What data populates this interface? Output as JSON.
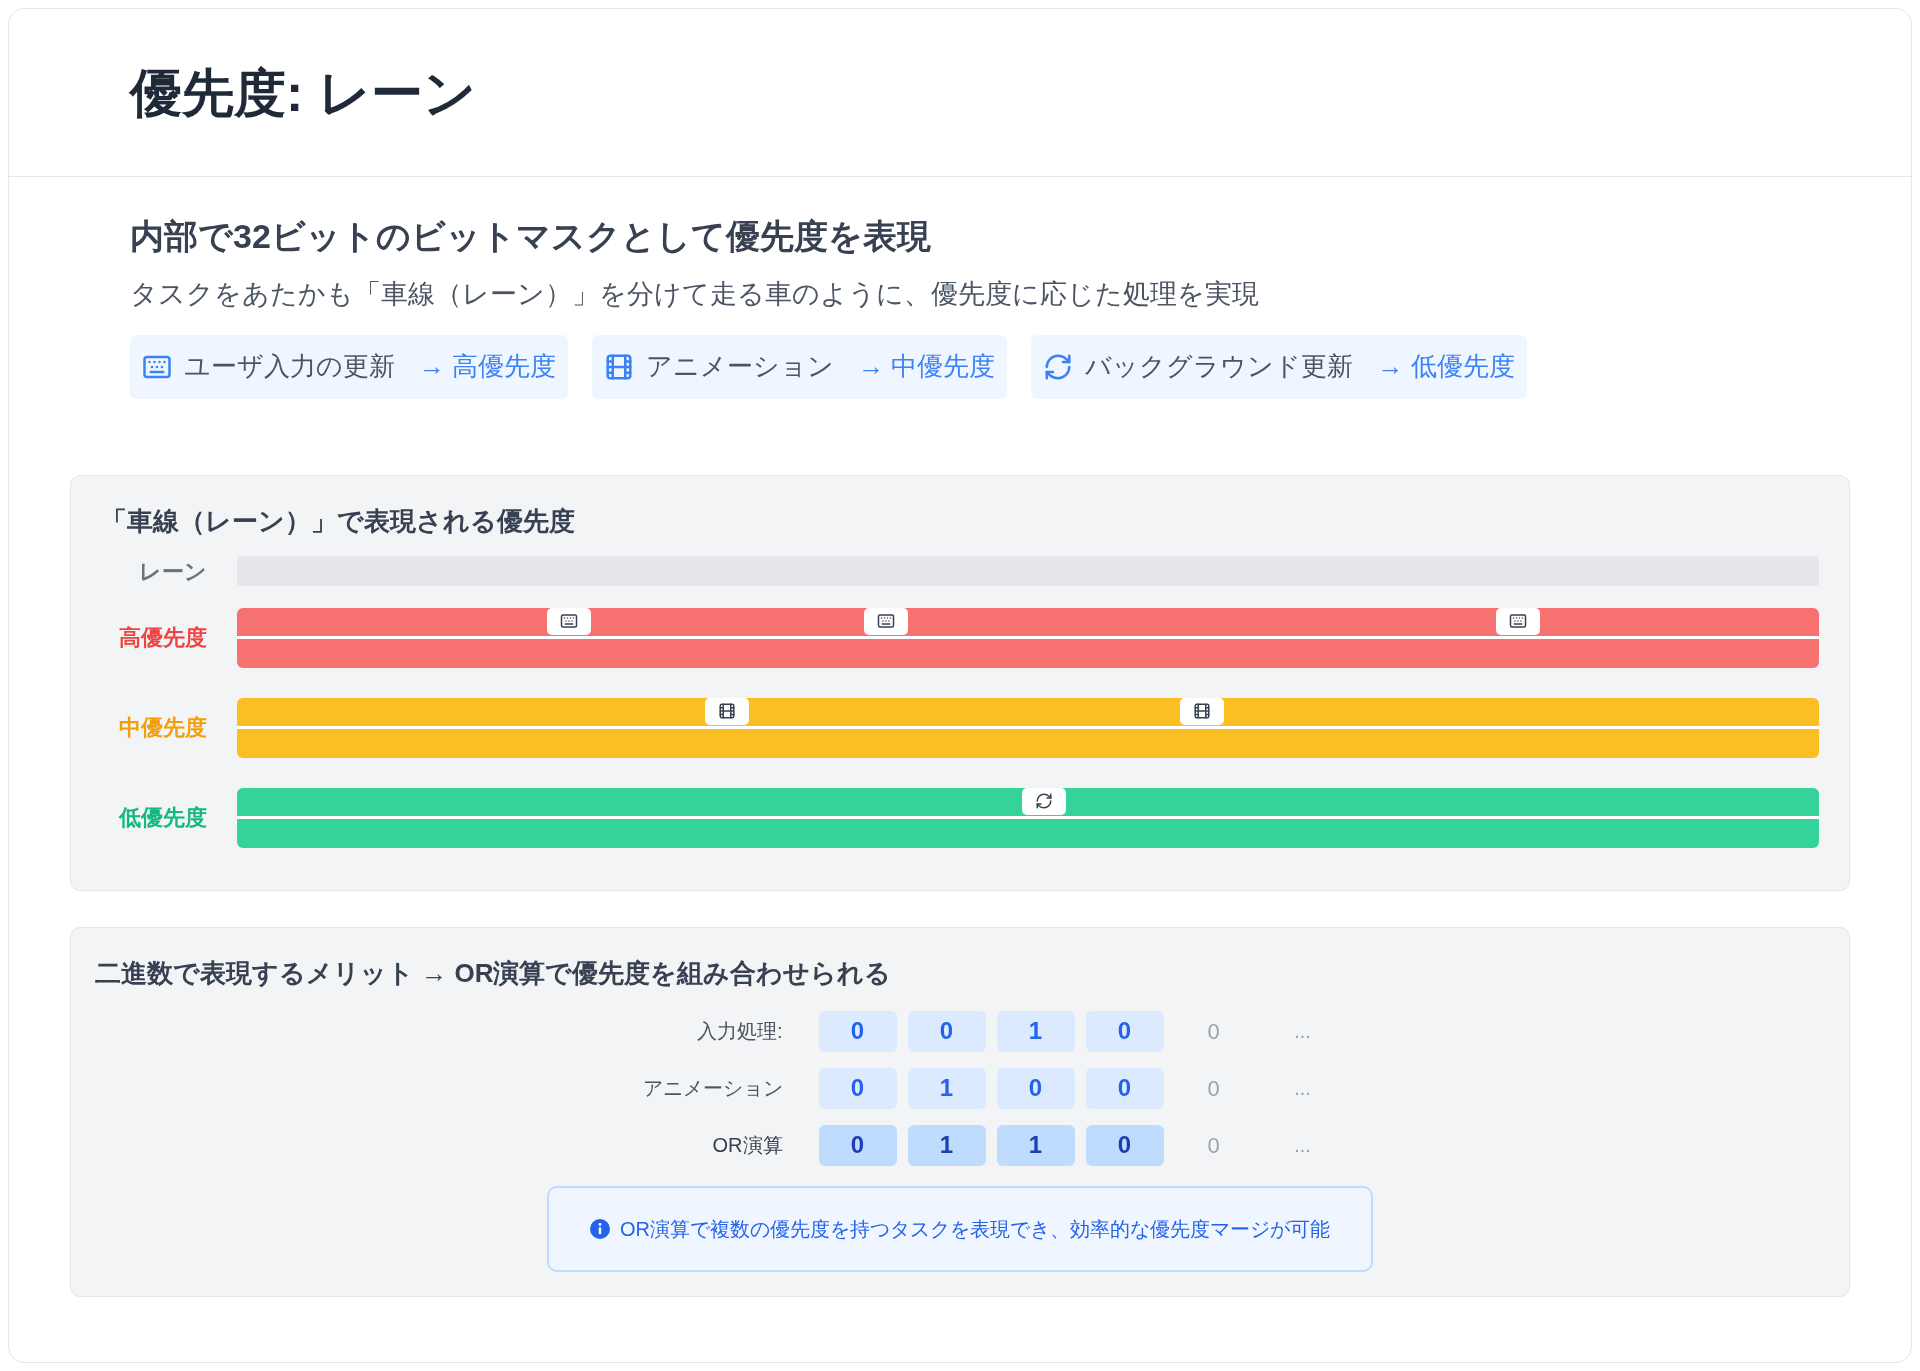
{
  "header": {
    "title": "優先度: レーン"
  },
  "intro": {
    "heading": "内部で32ビットのビットマスクとして優先度を表現",
    "description": "タスクをあたかも「車線（レーン）」を分けて走る車のように、優先度に応じた処理を実現",
    "tags": [
      {
        "kind": "high",
        "label": "ユーザ入力の更新",
        "priority": "→ 高優先度"
      },
      {
        "kind": "medium",
        "label": "アニメーション",
        "priority": "→ 中優先度"
      },
      {
        "kind": "low",
        "label": "バックグラウンド更新",
        "priority": "→ 低優先度"
      }
    ]
  },
  "lanes_panel": {
    "title": "「車線（レーン）」で表現される優先度",
    "header_label": "レーン",
    "lanes": [
      {
        "label": "高優先度",
        "kind": "high",
        "color": "#f87171",
        "tasks": [
          {
            "level": 0.21
          },
          {
            "level": 0.41
          },
          {
            "level": 0.81
          }
        ]
      },
      {
        "label": "中優先度",
        "kind": "medium",
        "color": "#fbbf24",
        "tasks": [
          {
            "level": 0.31
          },
          {
            "level": 0.61
          }
        ]
      },
      {
        "label": "低優先度",
        "kind": "low",
        "color": "#34d399",
        "tasks": [
          {
            "level": 0.51
          }
        ]
      }
    ]
  },
  "binary_panel": {
    "title": "二進数で表現するメリット → OR演算で優先度を組み合わせられる",
    "rows": [
      {
        "label": "入力処理:",
        "kind": "operand",
        "bits": [
          "0",
          "0",
          "1",
          "0"
        ],
        "extra": "0",
        "ellipsis": "..."
      },
      {
        "label": "アニメーション",
        "kind": "operand",
        "bits": [
          "0",
          "1",
          "0",
          "0"
        ],
        "extra": "0",
        "ellipsis": "..."
      },
      {
        "label": "OR演算",
        "kind": "result",
        "bits": [
          "0",
          "1",
          "1",
          "0"
        ],
        "extra": "0",
        "ellipsis": "..."
      }
    ],
    "note": "OR演算で複数の優先度を持つタスクを表現でき、効率的な優先度マージが可能"
  }
}
